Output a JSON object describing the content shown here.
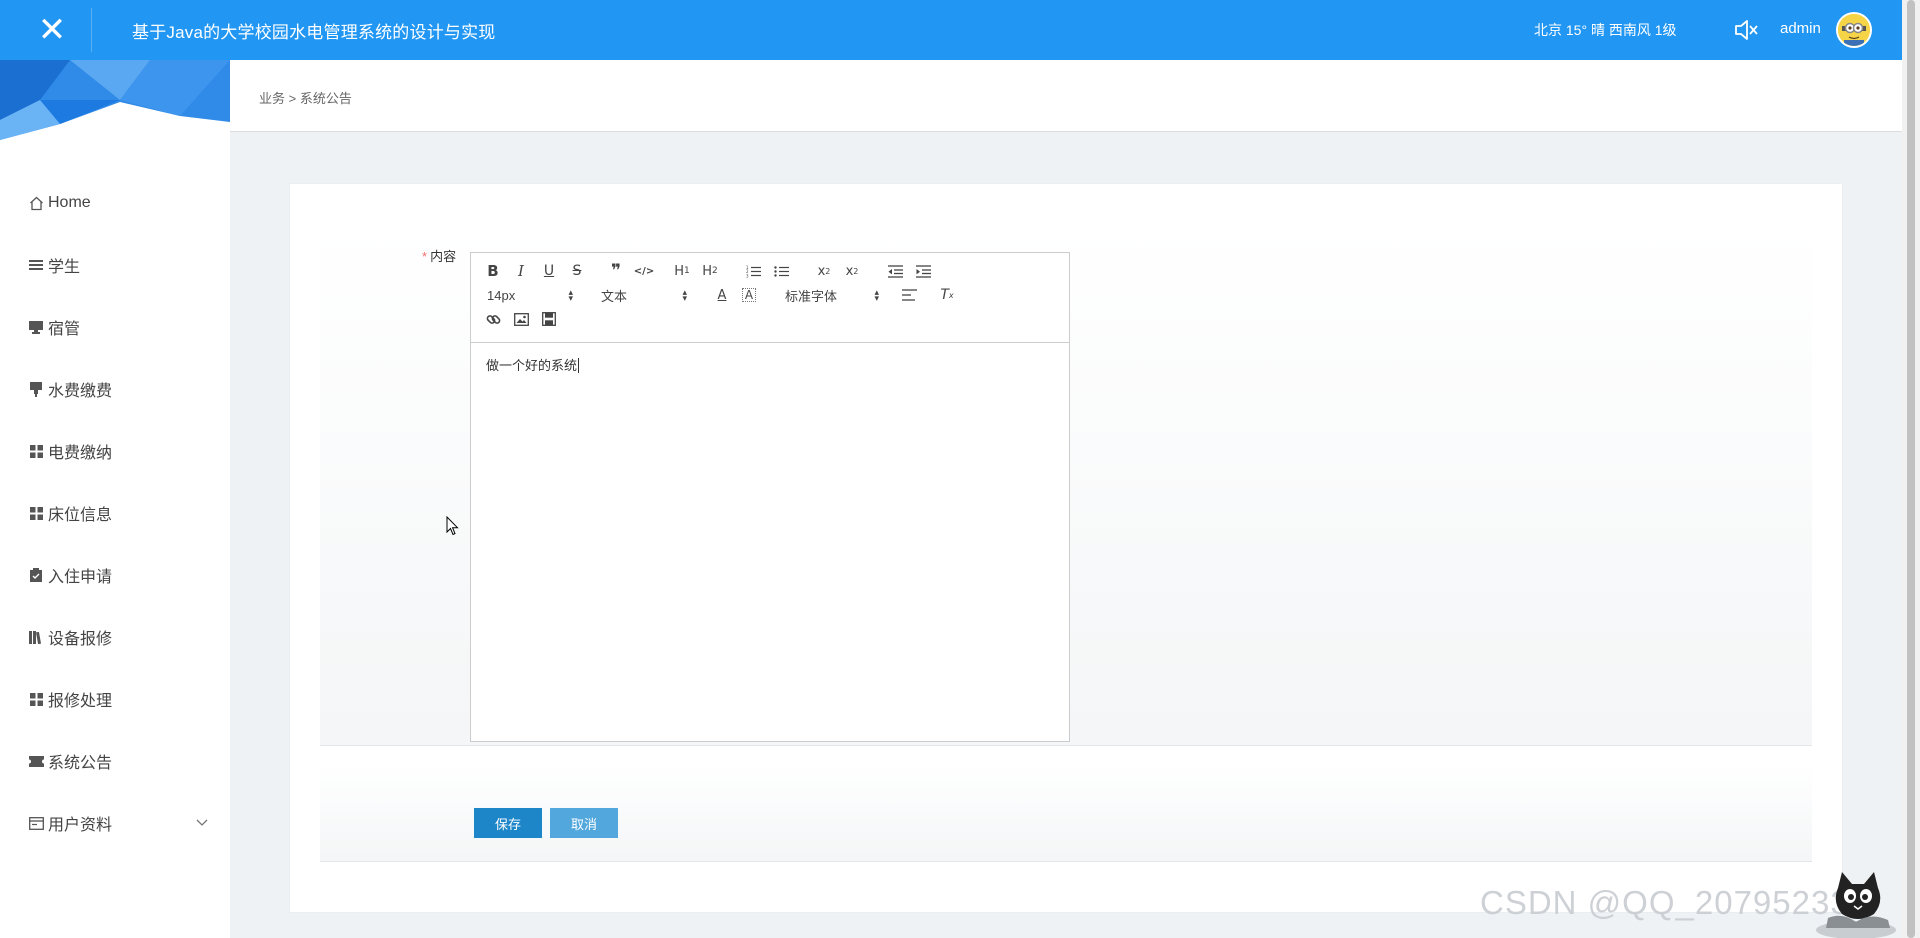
{
  "header": {
    "close_glyph": "✕",
    "title": "基于Java的大学校园水电管理系统的设计与实现",
    "weather": "北京  15°  晴  西南风  1级",
    "username": "admin"
  },
  "breadcrumb": "业务 > 系统公告",
  "sidebar": {
    "items": [
      {
        "label": "Home",
        "icon": "home-icon"
      },
      {
        "label": "学生",
        "icon": "list-icon"
      },
      {
        "label": "宿管",
        "icon": "monitor-icon"
      },
      {
        "label": "水费缴费",
        "icon": "tap-icon"
      },
      {
        "label": "电费缴纳",
        "icon": "grid-icon"
      },
      {
        "label": "床位信息",
        "icon": "grid-icon"
      },
      {
        "label": "入住申请",
        "icon": "clipboard-icon"
      },
      {
        "label": "设备报修",
        "icon": "books-icon"
      },
      {
        "label": "报修处理",
        "icon": "grid-icon"
      },
      {
        "label": "系统公告",
        "icon": "ticket-icon"
      },
      {
        "label": "用户资料",
        "icon": "card-icon",
        "expandable": true
      }
    ]
  },
  "form": {
    "required_mark": "*",
    "content_label": "内容",
    "editor": {
      "font_size": "14px",
      "paragraph": "文本",
      "font_family": "标准字体",
      "content": "做一个好的系统"
    },
    "save_label": "保存",
    "cancel_label": "取消"
  },
  "watermark": "CSDN @QQ_207952339",
  "colors": {
    "topbar": "#2196f3",
    "save_button": "#1d86c8",
    "cancel_button": "#52a7dc",
    "required": "#f56c6c"
  }
}
